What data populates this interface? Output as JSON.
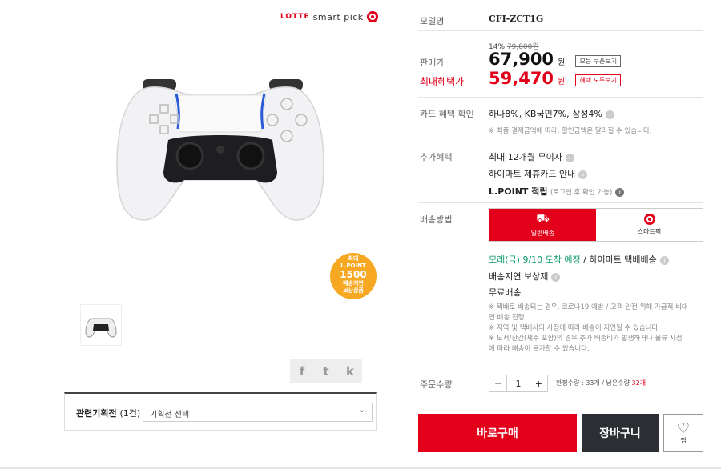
{
  "brand": {
    "name": "LOTTE",
    "suffix": "smart pick"
  },
  "badge": {
    "line1": "최대",
    "line2": "L.POINT",
    "points": "1500",
    "line3": "배송지연",
    "line4": "보상상품"
  },
  "share": {
    "facebook": "f",
    "twitter": "t",
    "other": "k"
  },
  "plan": {
    "label": "관련기획전",
    "count": "(1건)",
    "selected": "기획전 선택"
  },
  "model": {
    "label": "모델명",
    "value": "CFI-ZCT1G"
  },
  "price": {
    "discount_pct": "14%",
    "original": "79,800원",
    "sale_label": "판매가",
    "sale_value": "67,900",
    "unit": "원",
    "coupon_tag": "모든 쿠폰보기",
    "max_label": "최대혜택가",
    "max_value": "59,470",
    "max_tag": "혜택 모두보기"
  },
  "card": {
    "label": "카드 혜택 확인",
    "value": "하나8%, KB국민7%, 삼성4%",
    "note": "※ 최종 결제금액에 따라, 할인금액은 달라질 수 있습니다."
  },
  "extra": {
    "label": "추가혜택",
    "items": [
      "최대 12개월 무이자",
      "하이마트 제휴카드 안내"
    ],
    "lpoint": "L.POINT 적립",
    "lpoint_note": "(로그인 후 확인 가능)"
  },
  "shipping": {
    "label": "배송방법",
    "tabs": [
      "일반배송",
      "스마트픽"
    ],
    "eta": "모레(금) 9/10 도착 예정",
    "eta_suffix": "/ 하이마트 택배배송",
    "delay": "배송지연 보상제",
    "free": "무료배송",
    "notes": [
      "※ 택배로 배송되는 경우, 코로나19 예방 / 고객 안전 위해 가급적 비대",
      "면 배송 진행",
      "※ 지역 및 택배사의 사정에 따라 배송이 지연될 수 있습니다.",
      "※ 도서/산간(제주 포함)의 경우 추가 배송비가 발생하거나 물류 사정",
      "에 따라 배송이 불가할 수 있습니다."
    ]
  },
  "order": {
    "label": "주문수량",
    "minus": "−",
    "qty": "1",
    "plus": "+",
    "limit": "한정수량 : 33개 / 남은수량",
    "remaining": "32개"
  },
  "actions": {
    "buy": "바로구매",
    "cart": "장바구니",
    "wish": "찜"
  },
  "colors": {
    "accent": "#e2001a",
    "dark": "#2b2e33",
    "blue": "#1f5fd6"
  }
}
